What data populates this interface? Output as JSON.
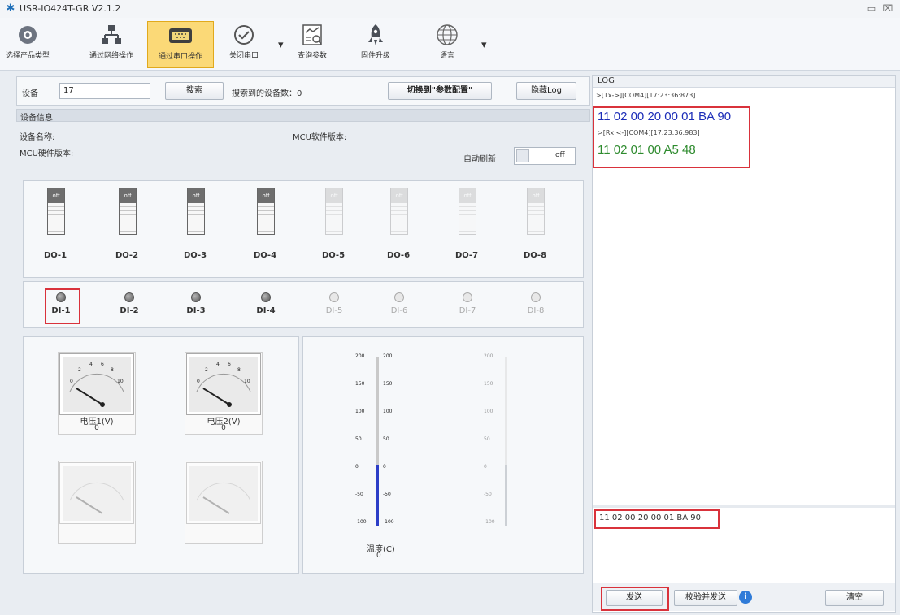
{
  "window": {
    "title": "USR-IO424T-GR V2.1.2",
    "minimize_glyph": "▭",
    "close_glyph": "⌧"
  },
  "toolbar": {
    "items": [
      {
        "label": "选择产品类型",
        "icon": "product-type-icon"
      },
      {
        "label": "通过网络操作",
        "icon": "network-icon"
      },
      {
        "label": "通过串口操作",
        "icon": "serial-port-icon"
      },
      {
        "label": "关闭串口",
        "icon": "close-port-icon"
      },
      {
        "label": "查询参数",
        "icon": "query-params-icon"
      },
      {
        "label": "固件升级",
        "icon": "firmware-upgrade-icon"
      },
      {
        "label": "语言",
        "icon": "language-icon"
      }
    ],
    "dropdown_glyph": "▾"
  },
  "device_bar": {
    "device_label": "设备",
    "device_value": "17",
    "search_label": "搜索",
    "found_count_label": "搜索到的设备数：0",
    "switch_params_label": "切换到\"参数配置\"",
    "hide_log_label": "隐藏Log"
  },
  "device_info": {
    "section_title": "设备信息",
    "device_name_label": "设备名称:",
    "mcu_software_label": "MCU软件版本:",
    "mcu_hardware_label": "MCU硬件版本:",
    "auto_refresh_label": "自动刷新",
    "auto_refresh_state": "off"
  },
  "digital_outputs": [
    {
      "label": "DO-1",
      "state": "off",
      "enabled": true
    },
    {
      "label": "DO-2",
      "state": "off",
      "enabled": true
    },
    {
      "label": "DO-3",
      "state": "off",
      "enabled": true
    },
    {
      "label": "DO-4",
      "state": "off",
      "enabled": true
    },
    {
      "label": "DO-5",
      "state": "off",
      "enabled": false
    },
    {
      "label": "DO-6",
      "state": "off",
      "enabled": false
    },
    {
      "label": "DO-7",
      "state": "off",
      "enabled": false
    },
    {
      "label": "DO-8",
      "state": "off",
      "enabled": false
    }
  ],
  "digital_inputs": [
    {
      "label": "DI-1",
      "enabled": true
    },
    {
      "label": "DI-2",
      "enabled": true
    },
    {
      "label": "DI-3",
      "enabled": true
    },
    {
      "label": "DI-4",
      "enabled": true
    },
    {
      "label": "DI-5",
      "enabled": false
    },
    {
      "label": "DI-6",
      "enabled": false
    },
    {
      "label": "DI-7",
      "enabled": false
    },
    {
      "label": "DI-8",
      "enabled": false
    }
  ],
  "gauges": [
    {
      "label": "电压1(V)",
      "value": "0",
      "enabled": true
    },
    {
      "label": "电压2(V)",
      "value": "0",
      "enabled": true
    },
    {
      "label": "",
      "value": "",
      "enabled": false
    },
    {
      "label": "",
      "value": "",
      "enabled": false
    }
  ],
  "gauge_scale": {
    "ticks": [
      "2",
      "4",
      "6",
      "8",
      "10"
    ],
    "left_tick": "0"
  },
  "thermometer": {
    "label": "温度(C)",
    "value": "0",
    "scale": [
      "200",
      "150",
      "100",
      "50",
      "0",
      "-50",
      "-100"
    ],
    "fill_fraction": 0.36
  },
  "thermometer_disabled": {
    "scale": [
      "200",
      "150",
      "100",
      "50",
      "0",
      "-50",
      "-100"
    ],
    "fill_fraction": 0.36
  },
  "log": {
    "title": "LOG",
    "entries": [
      {
        "header": ">[Tx->][COM4][17:23:36:873]",
        "data": "11 02 00 20 00 01 BA 90",
        "color": "#1c2db8"
      },
      {
        "header": ">[Rx <-][COM4][17:23:36:983]",
        "data": "11 02 01 00 A5 48",
        "color": "#2e8b2e"
      }
    ],
    "send_input": "11 02 00 20 00 01 BA 90",
    "send_label": "发送",
    "verify_send_label": "校验并发送",
    "info_glyph": "i",
    "clear_label": "清空"
  },
  "colors": {
    "accent_highlight": "#fbd977",
    "annotation_red": "#d9323b",
    "tx_blue": "#1c2db8",
    "rx_green": "#2e8b2e"
  }
}
